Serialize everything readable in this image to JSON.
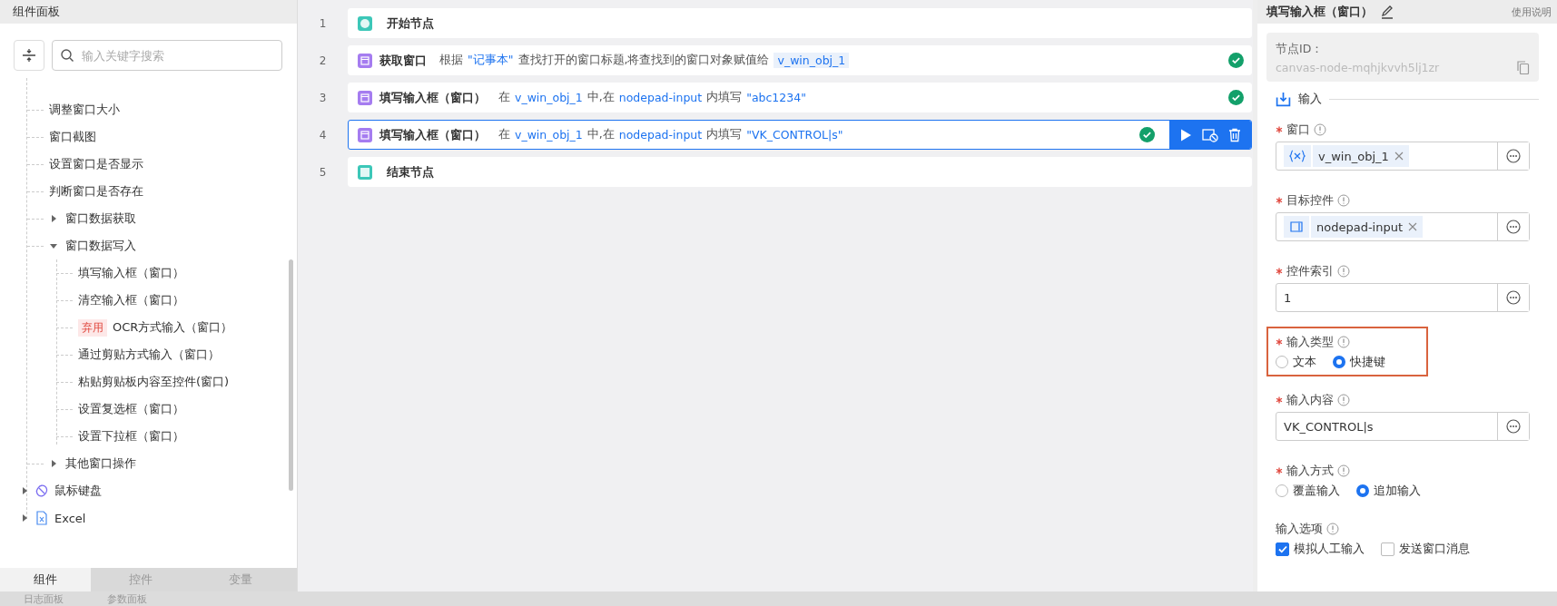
{
  "left_panel": {
    "title": "组件面板",
    "search": {
      "placeholder": "输入关键字搜索"
    },
    "tree": {
      "items": [
        {
          "label": "调整窗口大小"
        },
        {
          "label": "窗口截图"
        },
        {
          "label": "设置窗口是否显示"
        },
        {
          "label": "判断窗口是否存在"
        },
        {
          "label": "窗口数据获取",
          "expanded": false
        },
        {
          "label": "窗口数据写入",
          "expanded": true,
          "children": [
            {
              "label": "填写输入框（窗口）"
            },
            {
              "label": "清空输入框（窗口）"
            },
            {
              "label": "OCR方式输入（窗口）",
              "tag": "弃用"
            },
            {
              "label": "通过剪贴方式输入（窗口）"
            },
            {
              "label": "粘贴剪贴板内容至控件(窗口)"
            },
            {
              "label": "设置复选框（窗口）"
            },
            {
              "label": "设置下拉框（窗口）"
            }
          ]
        },
        {
          "label": "其他窗口操作",
          "expanded": false
        }
      ],
      "categories": [
        {
          "label": "鼠标键盘",
          "expanded": false
        },
        {
          "label": "Excel",
          "expanded": false
        }
      ]
    },
    "tabs": [
      {
        "label": "组件",
        "selected": true
      },
      {
        "label": "控件",
        "selected": false
      },
      {
        "label": "变量",
        "selected": false
      }
    ]
  },
  "flow": {
    "steps": [
      {
        "kind": "start",
        "number": "1",
        "title": "开始节点",
        "done": false,
        "selected": false
      },
      {
        "kind": "action",
        "number": "2",
        "title": "获取窗口",
        "done": true,
        "selected": false,
        "description": [
          {
            "kind": "plain",
            "text": "根据"
          },
          {
            "kind": "value",
            "text": "\"记事本\""
          },
          {
            "kind": "plain",
            "text": "查找打开的窗口标题,将查找到的窗口对象赋值给"
          },
          {
            "kind": "variable",
            "text": "v_win_obj_1"
          }
        ]
      },
      {
        "kind": "action",
        "number": "3",
        "title": "填写输入框（窗口）",
        "done": true,
        "selected": false,
        "description": [
          {
            "kind": "plain",
            "text": "在"
          },
          {
            "kind": "value",
            "text": "v_win_obj_1"
          },
          {
            "kind": "plain",
            "text": "中,在"
          },
          {
            "kind": "value",
            "text": "nodepad-input"
          },
          {
            "kind": "plain",
            "text": "内填写"
          },
          {
            "kind": "value",
            "text": "\"abc1234\""
          }
        ]
      },
      {
        "kind": "action",
        "number": "4",
        "title": "填写输入框（窗口）",
        "done": true,
        "selected": true,
        "description": [
          {
            "kind": "plain",
            "text": "在"
          },
          {
            "kind": "value",
            "text": "v_win_obj_1"
          },
          {
            "kind": "plain",
            "text": "中,在"
          },
          {
            "kind": "value",
            "text": "nodepad-input"
          },
          {
            "kind": "plain",
            "text": "内填写"
          },
          {
            "kind": "value",
            "text": "\"VK_CONTROL|s\""
          }
        ]
      },
      {
        "kind": "end",
        "number": "5",
        "title": "结束节点",
        "done": false,
        "selected": false
      }
    ]
  },
  "properties": {
    "title": "填写输入框（窗口）",
    "help_link": "使用说明",
    "node_id": {
      "label": "节点ID：",
      "value": "canvas-node-mqhjkvvh5lj1zr"
    },
    "section": "输入",
    "fields": [
      {
        "kind": "tag",
        "label": "窗口",
        "required": true,
        "highlighted": false,
        "tag": {
          "kind": "variable",
          "text": "v_win_obj_1"
        }
      },
      {
        "kind": "tag",
        "label": "目标控件",
        "required": true,
        "highlighted": false,
        "tag": {
          "kind": "element",
          "text": "nodepad-input"
        }
      },
      {
        "kind": "text",
        "label": "控件索引",
        "required": true,
        "highlighted": false,
        "value": "1"
      },
      {
        "kind": "radio",
        "label": "输入类型",
        "required": true,
        "highlighted": true,
        "options": [
          {
            "label": "文本",
            "selected": false
          },
          {
            "label": "快捷键",
            "selected": true
          }
        ]
      },
      {
        "kind": "text",
        "label": "输入内容",
        "required": true,
        "highlighted": false,
        "value": "VK_CONTROL|s"
      },
      {
        "kind": "radio",
        "label": "输入方式",
        "required": true,
        "highlighted": false,
        "options": [
          {
            "label": "覆盖输入",
            "selected": false
          },
          {
            "label": "追加输入",
            "selected": true
          }
        ]
      },
      {
        "kind": "checkbox",
        "label": "输入选项",
        "required": false,
        "highlighted": false,
        "options": [
          {
            "label": "模拟人工输入",
            "checked": true
          },
          {
            "label": "发送窗口消息",
            "checked": false
          }
        ]
      }
    ]
  },
  "bottom_tabs": [
    "日志面板",
    "参数面板"
  ]
}
